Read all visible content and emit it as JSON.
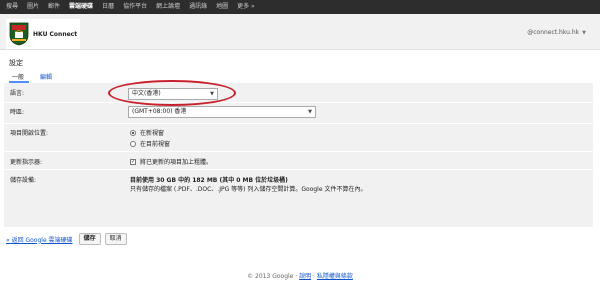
{
  "topnav": {
    "items": [
      "搜尋",
      "圖片",
      "郵件",
      "雲端硬碟",
      "日曆",
      "協作平台",
      "網上論壇",
      "通訊錄",
      "地圖",
      "更多 »"
    ],
    "active_index": 3
  },
  "header": {
    "logo_text": "HKU Connect",
    "account": "@connect.hku.hk"
  },
  "page_title": "設定",
  "tabs": {
    "general": "一般",
    "edit": "編輯"
  },
  "settings": {
    "language": {
      "label": "語言:",
      "value": "中文(香港)"
    },
    "timezone": {
      "label": "時區:",
      "value": "(GMT+08:00) 香港"
    },
    "open_location": {
      "label": "項目開啟位置:",
      "options": [
        "在新視窗",
        "在目前視窗"
      ],
      "selected": 0
    },
    "update_indicator": {
      "label": "更新指示器:",
      "checkbox_label": "將已更新的項目加上粗體。",
      "checked": true
    },
    "storage": {
      "label": "儲存設備:",
      "usage": "目前使用 30 GB 中的 182 MB (其中 0 MB 位於垃圾桶)",
      "note": "只有儲存的檔案 (.PDF、.DOC、.JPG 等等) 列入儲存空間計算。Google 文件不算在內。"
    }
  },
  "footer": {
    "back_link": "« 返回 Google 雲端硬碟",
    "save": "儲存",
    "cancel": "取消"
  },
  "copyright": {
    "text": "© 2013 Google · ",
    "terms": "說明",
    "separator": " · ",
    "privacy": "私隱權與條款"
  },
  "colors": {
    "topbar": "#2d2d2d",
    "panel": "#f1f1f1",
    "link": "#1155cc",
    "highlight": "#c8202a"
  }
}
